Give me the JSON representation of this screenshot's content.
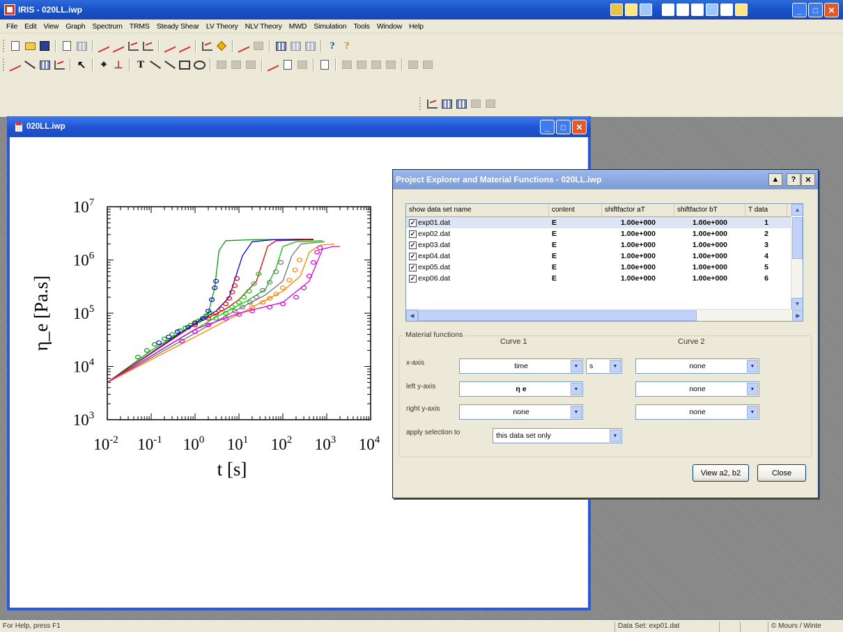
{
  "app": {
    "title": "IRIS - 020LL.iwp"
  },
  "menu": [
    "File",
    "Edit",
    "View",
    "Graph",
    "Spectrum",
    "TRMS",
    "Steady Shear",
    "LV Theory",
    "NLV Theory",
    "MWD",
    "Simulation",
    "Tools",
    "Window",
    "Help"
  ],
  "document": {
    "title": "020LL.iwp"
  },
  "chart_data": {
    "type": "scatter",
    "xscale": "log",
    "yscale": "log",
    "xlim": [
      0.01,
      10000
    ],
    "ylim": [
      1000,
      10000000
    ],
    "xlabel": "t [s]",
    "ylabel": "η_e [Pa.s]",
    "x_tick_labels": [
      {
        "base": "10",
        "exp": "-2"
      },
      {
        "base": "10",
        "exp": "-1"
      },
      {
        "base": "10",
        "exp": "0"
      },
      {
        "base": "10",
        "exp": "1"
      },
      {
        "base": "10",
        "exp": "2"
      },
      {
        "base": "10",
        "exp": "3"
      },
      {
        "base": "10",
        "exp": "4"
      }
    ],
    "y_tick_labels": [
      {
        "base": "10",
        "exp": "3"
      },
      {
        "base": "10",
        "exp": "4"
      },
      {
        "base": "10",
        "exp": "5"
      },
      {
        "base": "10",
        "exp": "6"
      },
      {
        "base": "10",
        "exp": "7"
      }
    ],
    "series": [
      {
        "color": "#00a000",
        "points": [
          [
            0.05,
            15000
          ],
          [
            0.08,
            20000
          ],
          [
            0.12,
            26000
          ],
          [
            0.2,
            33000
          ],
          [
            0.3,
            40000
          ],
          [
            0.45,
            47000
          ],
          [
            0.6,
            53000
          ],
          [
            0.8,
            60000
          ],
          [
            1.0,
            67000
          ],
          [
            1.2,
            72000
          ],
          [
            1.5,
            80000
          ],
          [
            1.8,
            90000
          ],
          [
            2.2,
            100000
          ]
        ],
        "fit": [
          [
            0.01,
            5000
          ],
          [
            0.1,
            20000
          ],
          [
            0.5,
            45000
          ],
          [
            1.0,
            65000
          ],
          [
            2.0,
            100000
          ],
          [
            2.8,
            300000
          ],
          [
            3.5,
            1500000
          ],
          [
            5.0,
            2300000
          ],
          [
            20,
            2400000
          ],
          [
            300,
            2450000
          ]
        ]
      },
      {
        "color": "#0000e0",
        "points": [
          [
            0.15,
            28000
          ],
          [
            0.25,
            36000
          ],
          [
            0.4,
            45000
          ],
          [
            0.7,
            55000
          ],
          [
            1.0,
            65000
          ],
          [
            1.5,
            80000
          ],
          [
            2.0,
            110000
          ],
          [
            2.4,
            180000
          ],
          [
            2.8,
            300000
          ],
          [
            3.0,
            400000
          ]
        ],
        "fit": [
          [
            0.01,
            5000
          ],
          [
            1.0,
            65000
          ],
          [
            3.0,
            110000
          ],
          [
            6.0,
            200000
          ],
          [
            12,
            1200000
          ],
          [
            20,
            2200000
          ],
          [
            60,
            2400000
          ],
          [
            500,
            2450000
          ]
        ]
      },
      {
        "color": "#e00000",
        "points": [
          [
            1.0,
            60000
          ],
          [
            2.0,
            80000
          ],
          [
            3.0,
            100000
          ],
          [
            4.0,
            120000
          ],
          [
            5.0,
            150000
          ],
          [
            6.0,
            190000
          ],
          [
            7.0,
            250000
          ],
          [
            8.0,
            330000
          ],
          [
            9.0,
            450000
          ]
        ],
        "fit": [
          [
            0.01,
            5000
          ],
          [
            1.0,
            62000
          ],
          [
            5.0,
            120000
          ],
          [
            10,
            180000
          ],
          [
            25,
            400000
          ],
          [
            45,
            1800000
          ],
          [
            70,
            2300000
          ],
          [
            500,
            2400000
          ]
        ]
      },
      {
        "color": "#00cc00",
        "points": [
          [
            3,
            80000
          ],
          [
            5,
            100000
          ],
          [
            7,
            130000
          ],
          [
            10,
            160000
          ],
          [
            13,
            200000
          ],
          [
            17,
            260000
          ],
          [
            22,
            360000
          ],
          [
            28,
            550000
          ]
        ],
        "fit": [
          [
            0.01,
            5000
          ],
          [
            3,
            85000
          ],
          [
            15,
            170000
          ],
          [
            40,
            280000
          ],
          [
            70,
            700000
          ],
          [
            100,
            1800000
          ],
          [
            200,
            2200000
          ],
          [
            800,
            2300000
          ]
        ]
      },
      {
        "color": "#707070",
        "points": [
          [
            8,
            110000
          ],
          [
            12,
            130000
          ],
          [
            18,
            160000
          ],
          [
            25,
            200000
          ],
          [
            35,
            270000
          ],
          [
            50,
            380000
          ],
          [
            70,
            600000
          ],
          [
            90,
            900000
          ]
        ],
        "fit": [
          [
            0.01,
            5000
          ],
          [
            8,
            110000
          ],
          [
            40,
            220000
          ],
          [
            100,
            400000
          ],
          [
            160,
            1200000
          ],
          [
            260,
            2000000
          ],
          [
            900,
            2200000
          ]
        ]
      },
      {
        "color": "#ff8000",
        "points": [
          [
            20,
            130000
          ],
          [
            35,
            160000
          ],
          [
            50,
            190000
          ],
          [
            70,
            230000
          ],
          [
            100,
            300000
          ],
          [
            140,
            420000
          ],
          [
            190,
            650000
          ],
          [
            240,
            1000000
          ]
        ],
        "fit": [
          [
            0.01,
            5000
          ],
          [
            20,
            130000
          ],
          [
            100,
            260000
          ],
          [
            250,
            500000
          ],
          [
            400,
            1400000
          ],
          [
            700,
            1900000
          ],
          [
            1500,
            2000000
          ]
        ]
      },
      {
        "color": "#e000e0",
        "points": [
          [
            0.5,
            30000
          ],
          [
            1.0,
            45000
          ],
          [
            2.0,
            60000
          ],
          [
            5.0,
            80000
          ],
          [
            10,
            95000
          ],
          [
            20,
            110000
          ],
          [
            50,
            130000
          ],
          [
            100,
            150000
          ],
          [
            200,
            200000
          ],
          [
            300,
            300000
          ],
          [
            400,
            500000
          ],
          [
            500,
            900000
          ],
          [
            600,
            1400000
          ],
          [
            700,
            1700000
          ]
        ],
        "fit": [
          [
            0.01,
            5000
          ],
          [
            1,
            50000
          ],
          [
            10,
            100000
          ],
          [
            100,
            160000
          ],
          [
            400,
            400000
          ],
          [
            800,
            1600000
          ],
          [
            1400,
            1800000
          ],
          [
            2000,
            1800000
          ]
        ]
      }
    ]
  },
  "dialog": {
    "title": "Project Explorer and Material Functions - 020LL.iwp",
    "columns": [
      "show  data set name",
      "content",
      "shiftfactor aT",
      "shiftfactor bT",
      "T data"
    ],
    "rows": [
      {
        "name": "exp01.dat",
        "content": "E",
        "aT": "1.00e+000",
        "bT": "1.00e+000",
        "T": "1"
      },
      {
        "name": "exp02.dat",
        "content": "E",
        "aT": "1.00e+000",
        "bT": "1.00e+000",
        "T": "2"
      },
      {
        "name": "exp03.dat",
        "content": "E",
        "aT": "1.00e+000",
        "bT": "1.00e+000",
        "T": "3"
      },
      {
        "name": "exp04.dat",
        "content": "E",
        "aT": "1.00e+000",
        "bT": "1.00e+000",
        "T": "4"
      },
      {
        "name": "exp05.dat",
        "content": "E",
        "aT": "1.00e+000",
        "bT": "1.00e+000",
        "T": "5"
      },
      {
        "name": "exp06.dat",
        "content": "E",
        "aT": "1.00e+000",
        "bT": "1.00e+000",
        "T": "6"
      }
    ],
    "material_functions": {
      "legend": "Material functions",
      "curve1_header": "Curve 1",
      "curve2_header": "Curve 2",
      "x_axis_label": "x-axis",
      "left_y_label": "left y-axis",
      "right_y_label": "right y-axis",
      "apply_label": "apply selection to",
      "x_axis_value": "time",
      "x_unit_value": "s",
      "left_y_value": "η e",
      "right_y_value": "none",
      "curve2_x": "none",
      "curve2_left": "none",
      "curve2_right": "none",
      "apply_value": "this data set only"
    },
    "buttons": {
      "view": "View a2, b2",
      "close": "Close"
    }
  },
  "status": {
    "help": "For Help, press F1",
    "dataset": "Data Set: exp01.dat",
    "user": "© Mours / Winte"
  }
}
